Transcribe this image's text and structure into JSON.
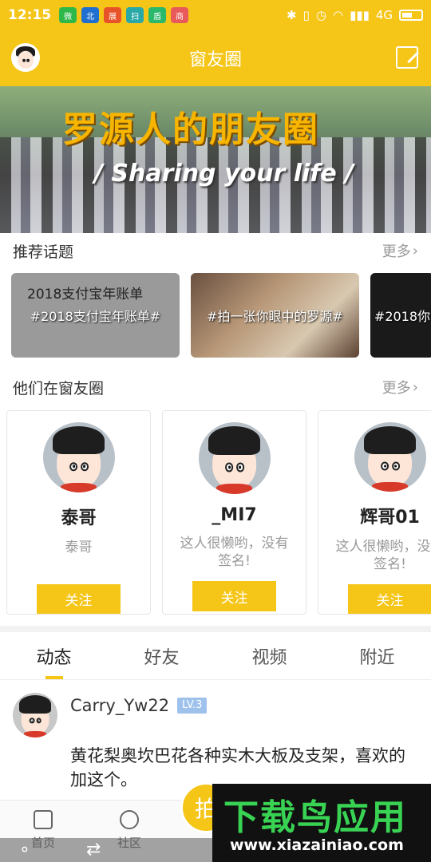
{
  "status_bar": {
    "time": "12:15",
    "network": "4G",
    "apps": [
      "微",
      "北",
      "展",
      "扫",
      "盾",
      "商"
    ]
  },
  "header": {
    "title": "窗友圈"
  },
  "banner": {
    "title": "罗源人的朋友圈",
    "subtitle": "/ Sharing your life /"
  },
  "topics_section": {
    "label": "推荐话题",
    "more": "更多",
    "items": [
      {
        "label": "#2018支付宝年账单#",
        "paper_title": "2018支付宝年账单"
      },
      {
        "label": "#拍一张你眼中的罗源#"
      },
      {
        "label": "#2018你"
      }
    ]
  },
  "users_section": {
    "label": "他们在窗友圈",
    "more": "更多",
    "users": [
      {
        "name": "泰哥",
        "sign": "泰哥",
        "follow": "关注"
      },
      {
        "name": "_MI7",
        "sign": "这人很懒哟，没有签名!",
        "follow": "关注"
      },
      {
        "name": "辉哥01",
        "sign": "这人很懒哟，没有签名!",
        "follow": "关注"
      }
    ]
  },
  "tabs": [
    {
      "label": "动态",
      "active": true
    },
    {
      "label": "好友",
      "active": false
    },
    {
      "label": "视频",
      "active": false
    },
    {
      "label": "附近",
      "active": false
    }
  ],
  "post": {
    "username": "Carry_Yw22",
    "level": "LV.3",
    "text": "黄花梨奥坎巴花各种实木大板及支架，喜欢的加这个。"
  },
  "bottom_nav": {
    "home": "首页",
    "community": "社区",
    "fab": "拍"
  },
  "watermark": {
    "name": "下载鸟应用",
    "url": "www.xiazainiao.com"
  },
  "colors": {
    "brand": "#f5c518",
    "level_badge": "#9ec2ec"
  }
}
